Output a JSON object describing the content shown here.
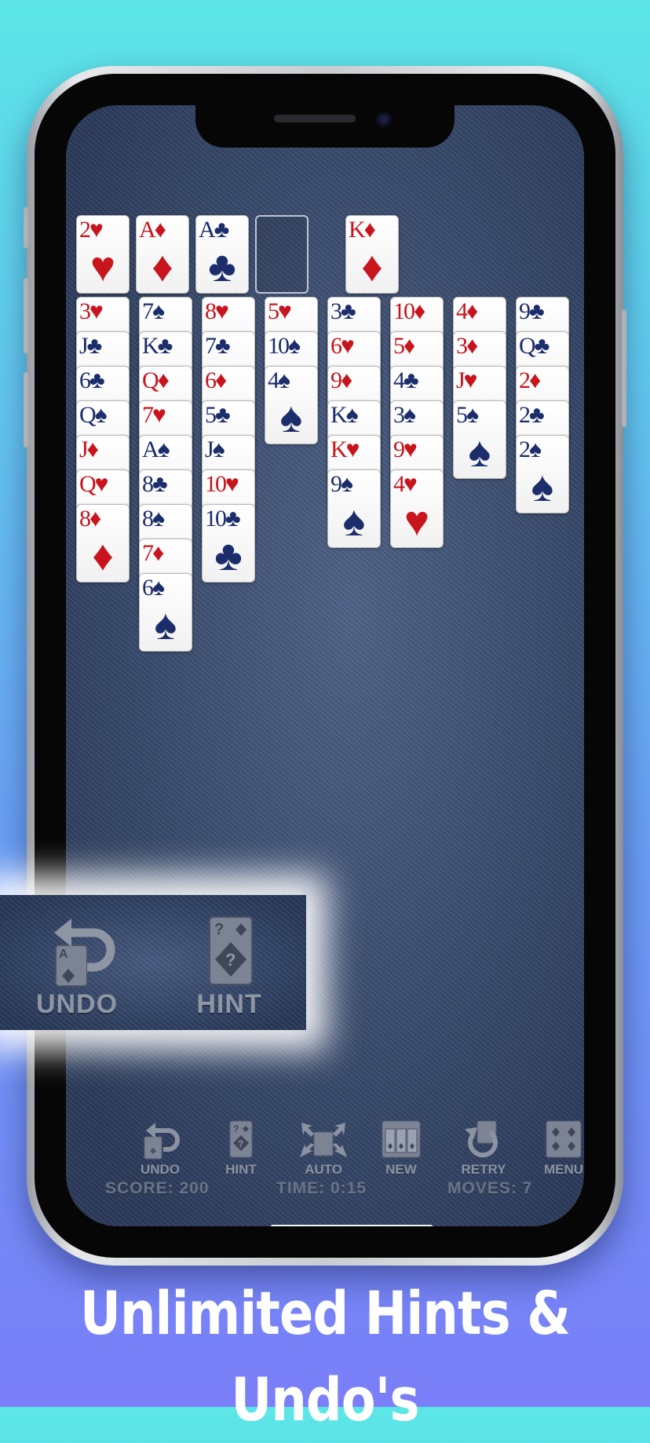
{
  "caption": "Unlimited Hints & Undo's",
  "colors": {
    "red_suit": "#c8141c",
    "black_suit": "#1c2d6b",
    "felt": "#3a4e73"
  },
  "free_cells": [
    {
      "rank": "2",
      "suit": "♥",
      "color": "red"
    },
    {
      "rank": "A",
      "suit": "♦",
      "color": "red"
    },
    {
      "rank": "A",
      "suit": "♣",
      "color": "blue"
    },
    null
  ],
  "foundations": [
    {
      "rank": "K",
      "suit": "♦",
      "color": "red"
    }
  ],
  "tableau": [
    [
      "3♥",
      "J♣",
      "6♣",
      "Q♠",
      "J♦",
      "Q♥",
      "8♦"
    ],
    [
      "7♠",
      "K♣",
      "Q♦",
      "7♥",
      "A♠",
      "8♣",
      "8♠",
      "7♦",
      "6♠"
    ],
    [
      "8♥",
      "7♣",
      "6♦",
      "5♣",
      "J♠",
      "10♥",
      "10♣"
    ],
    [
      "5♥",
      "10♠",
      "4♠"
    ],
    [
      "3♣",
      "6♥",
      "9♦",
      "K♠",
      "K♥",
      "9♠"
    ],
    [
      "10♦",
      "5♦",
      "4♣",
      "3♠",
      "9♥",
      "4♥"
    ],
    [
      "4♦",
      "3♦",
      "J♥",
      "5♠"
    ],
    [
      "9♣",
      "Q♣",
      "2♦",
      "2♣",
      "2♠"
    ]
  ],
  "zoom": {
    "undo_label": "UNDO",
    "hint_label": "HINT",
    "undo_icon": "undo-arrow-icon",
    "hint_icon": "hint-card-icon"
  },
  "toolbar": [
    {
      "label": "UNDO",
      "icon": "undo-icon"
    },
    {
      "label": "HINT",
      "icon": "hint-icon"
    },
    {
      "label": "AUTO",
      "icon": "auto-icon"
    },
    {
      "label": "NEW",
      "icon": "new-game-icon"
    },
    {
      "label": "RETRY",
      "icon": "retry-icon"
    },
    {
      "label": "MENU",
      "icon": "menu-icon"
    }
  ],
  "stats": {
    "score": "SCORE: 200",
    "time": "TIME: 0:15",
    "moves": "MOVES: 7"
  }
}
